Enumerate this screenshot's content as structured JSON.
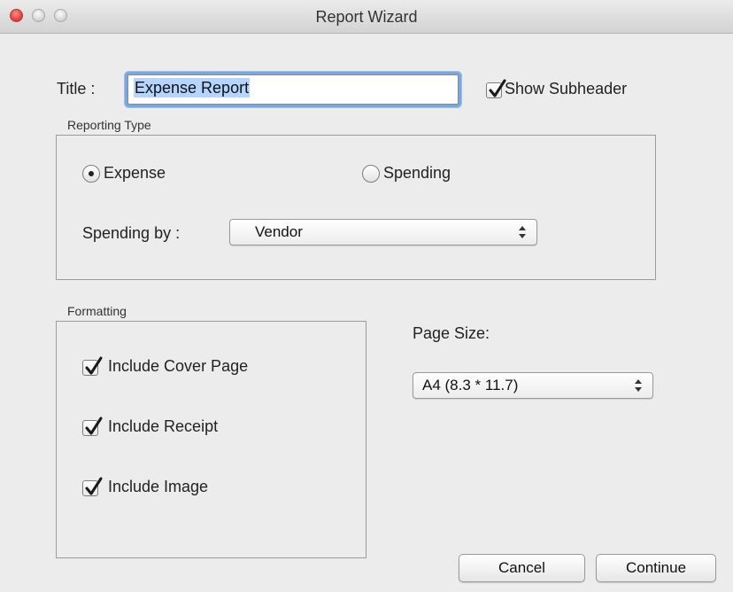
{
  "window": {
    "title": "Report Wizard"
  },
  "title_row": {
    "label": "Title :",
    "value": "Expense Report",
    "show_subheader": {
      "label": "Show Subheader",
      "checked": true
    }
  },
  "reporting_type": {
    "group_label": "Reporting Type",
    "options": [
      {
        "label": "Expense",
        "selected": true
      },
      {
        "label": "Spending",
        "selected": false
      }
    ],
    "spending_by": {
      "label": "Spending by :",
      "selected": "Vendor"
    }
  },
  "formatting": {
    "group_label": "Formatting",
    "items": [
      {
        "label": "Include Cover Page",
        "checked": true
      },
      {
        "label": "Include Receipt",
        "checked": true
      },
      {
        "label": "Include Image",
        "checked": true
      }
    ]
  },
  "page_size": {
    "label": "Page Size:",
    "selected": "A4 (8.3 * 11.7)"
  },
  "buttons": {
    "cancel": "Cancel",
    "continue": "Continue"
  },
  "colors": {
    "focus_ring": "#7aa7e0",
    "selection": "#b5d5ff",
    "close_button": "#e0443e"
  }
}
